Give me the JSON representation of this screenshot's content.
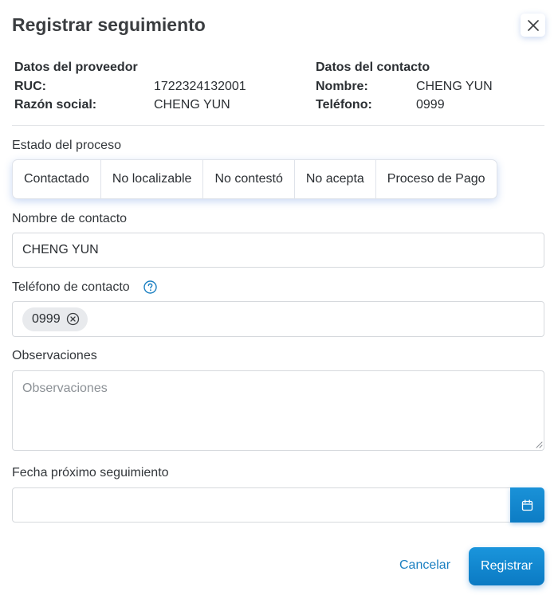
{
  "dialog": {
    "title": "Registrar seguimiento"
  },
  "proveedor": {
    "heading": "Datos del proveedor",
    "ruc_label": "RUC:",
    "ruc_value": "1722324132001",
    "razon_label": "Razón social:",
    "razon_value": "CHENG YUN"
  },
  "contacto": {
    "heading": "Datos del contacto",
    "nombre_label": "Nombre:",
    "nombre_value": "CHENG YUN",
    "telefono_label": "Teléfono:",
    "telefono_value": "0999"
  },
  "estado": {
    "label": "Estado del proceso",
    "options": [
      "Contactado",
      "No localizable",
      "No contestó",
      "No acepta",
      "Proceso de Pago"
    ]
  },
  "nombre_contacto": {
    "label": "Nombre de contacto",
    "value": "CHENG YUN"
  },
  "telefono_contacto": {
    "label": "Teléfono de contacto",
    "chip": "0999"
  },
  "observaciones": {
    "label": "Observaciones",
    "placeholder": "Observaciones"
  },
  "fecha": {
    "label": "Fecha próximo seguimiento",
    "value": ""
  },
  "actions": {
    "cancel": "Cancelar",
    "submit": "Registrar"
  }
}
